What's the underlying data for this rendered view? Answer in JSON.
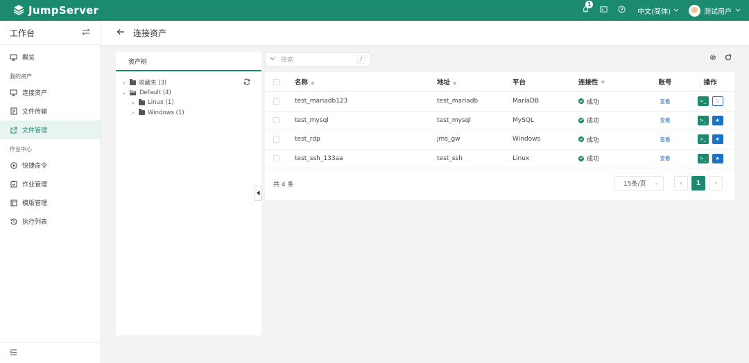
{
  "app": {
    "name": "JumpServer"
  },
  "topbar": {
    "notification_count": "1",
    "language": "中文(简体)",
    "user": "测试用户"
  },
  "sidebar": {
    "title": "工作台",
    "items": [
      {
        "label": "概览",
        "icon": "monitor-icon"
      },
      {
        "label": "连接资产",
        "icon": "desktop-icon"
      },
      {
        "label": "文件传输",
        "icon": "file-transfer-icon"
      },
      {
        "label": "文件管理",
        "icon": "external-link-icon",
        "active": true
      },
      {
        "label": "快捷命令",
        "icon": "play-circle-icon"
      },
      {
        "label": "作业管理",
        "icon": "clipboard-icon"
      },
      {
        "label": "模版管理",
        "icon": "template-icon"
      },
      {
        "label": "执行列表",
        "icon": "history-icon"
      }
    ],
    "groups": [
      "我的资产",
      "作业中心"
    ]
  },
  "page": {
    "title": "连接资产"
  },
  "tree": {
    "tab": "资产树",
    "nodes": [
      {
        "label": "收藏夹 (3)"
      },
      {
        "label": "Default (4)"
      },
      {
        "label": "Linux (1)"
      },
      {
        "label": "Windows (1)"
      }
    ]
  },
  "search": {
    "placeholder": "搜索",
    "shortcut": "/"
  },
  "table": {
    "headers": {
      "name": "名称",
      "address": "地址",
      "platform": "平台",
      "connectivity": "连接性",
      "account": "账号",
      "actions": "操作"
    },
    "rows": [
      {
        "name": "test_mariadb123",
        "address": "test_mariadb",
        "platform": "MariaDB",
        "connectivity": "成功",
        "account": "查看",
        "starred": false
      },
      {
        "name": "test_mysql",
        "address": "test_mysql",
        "platform": "MySQL",
        "connectivity": "成功",
        "account": "查看",
        "starred": true
      },
      {
        "name": "test_rdp",
        "address": "jms_gw",
        "platform": "Windows",
        "connectivity": "成功",
        "account": "查看",
        "starred": true
      },
      {
        "name": "test_ssh_133aa",
        "address": "test_ssh",
        "platform": "Linux",
        "connectivity": "成功",
        "account": "查看",
        "starred": true
      }
    ],
    "total": "共 4 条",
    "page_size": "15条/页",
    "current_page": "1"
  },
  "colors": {
    "brand": "#1c8a6f",
    "star": "#1a73c5"
  }
}
